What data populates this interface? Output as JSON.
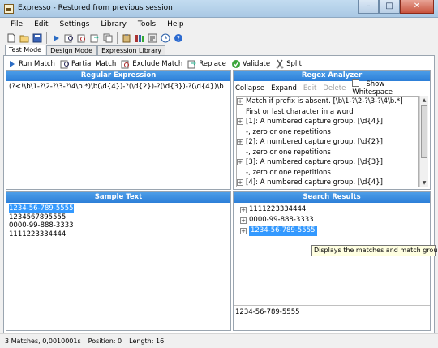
{
  "window": {
    "title": "Expresso - Restored from previous session"
  },
  "menu": [
    "File",
    "Edit",
    "Settings",
    "Library",
    "Tools",
    "Help"
  ],
  "toolbar": {
    "icons": [
      "new-icon",
      "open-icon",
      "save-icon",
      "run-icon",
      "find-icon",
      "find-all-icon",
      "replace-icon",
      "copy-icon",
      "paste-icon",
      "library-icon",
      "settings-icon",
      "clock-icon",
      "help-icon"
    ]
  },
  "tabs": [
    {
      "label": "Test Mode",
      "active": true
    },
    {
      "label": "Design Mode",
      "active": false
    },
    {
      "label": "Expression Library",
      "active": false
    }
  ],
  "actions": [
    {
      "label": "Run Match",
      "icon": "play-icon"
    },
    {
      "label": "Partial Match",
      "icon": "partial-match-icon"
    },
    {
      "label": "Exclude Match",
      "icon": "exclude-match-icon"
    },
    {
      "label": "Replace",
      "icon": "replace-icon"
    },
    {
      "label": "Validate",
      "icon": "check-icon"
    },
    {
      "label": "Split",
      "icon": "split-icon"
    }
  ],
  "regex_panel": {
    "title": "Regular Expression",
    "expression": "(?<!\\b\\1-?\\2-?\\3-?\\4\\b.*)\\b(\\d{4})-?(\\d{2})-?(\\d{3})-?(\\d{4})\\b"
  },
  "analyzer": {
    "title": "Regex Analyzer",
    "toolbar": {
      "collapse": "Collapse",
      "expand": "Expand",
      "edit": "Edit",
      "delete": "Delete",
      "show_ws": "Show Whitespace"
    },
    "tree": [
      {
        "text": "Match if prefix is absent. [\\b\\1-?\\2-?\\3-?\\4\\b.*]",
        "depth": 0,
        "expander": "+"
      },
      {
        "text": "First or last character in a word",
        "depth": 0,
        "expander": ""
      },
      {
        "text": "[1]: A numbered capture group. [\\d{4}]",
        "depth": 0,
        "expander": "+"
      },
      {
        "text": "-, zero or one repetitions",
        "depth": 0,
        "expander": ""
      },
      {
        "text": "[2]: A numbered capture group. [\\d{2}]",
        "depth": 0,
        "expander": "+"
      },
      {
        "text": "-, zero or one repetitions",
        "depth": 0,
        "expander": ""
      },
      {
        "text": "[3]: A numbered capture group. [\\d{3}]",
        "depth": 0,
        "expander": "+"
      },
      {
        "text": "-, zero or one repetitions",
        "depth": 0,
        "expander": ""
      },
      {
        "text": "[4]: A numbered capture group. [\\d{4}]",
        "depth": 0,
        "expander": "+"
      }
    ]
  },
  "sample": {
    "title": "Sample Text",
    "lines": [
      "1234-56-789-5555",
      "1234567895555",
      "0000-99-888-3333",
      "1111223334444"
    ]
  },
  "results": {
    "title": "Search Results",
    "items": [
      "1111223334444",
      "0000-99-888-3333",
      "1234-56-789-5555"
    ],
    "tooltip": "Displays the matches and match groups",
    "selected_value": "1234-56-789-5555"
  },
  "status": {
    "matches": "3 Matches, 0,0010001s",
    "position": "Position: 0",
    "length": "Length: 16"
  },
  "colors": {
    "header": "#2d7fd8",
    "selection": "#3399ff"
  }
}
